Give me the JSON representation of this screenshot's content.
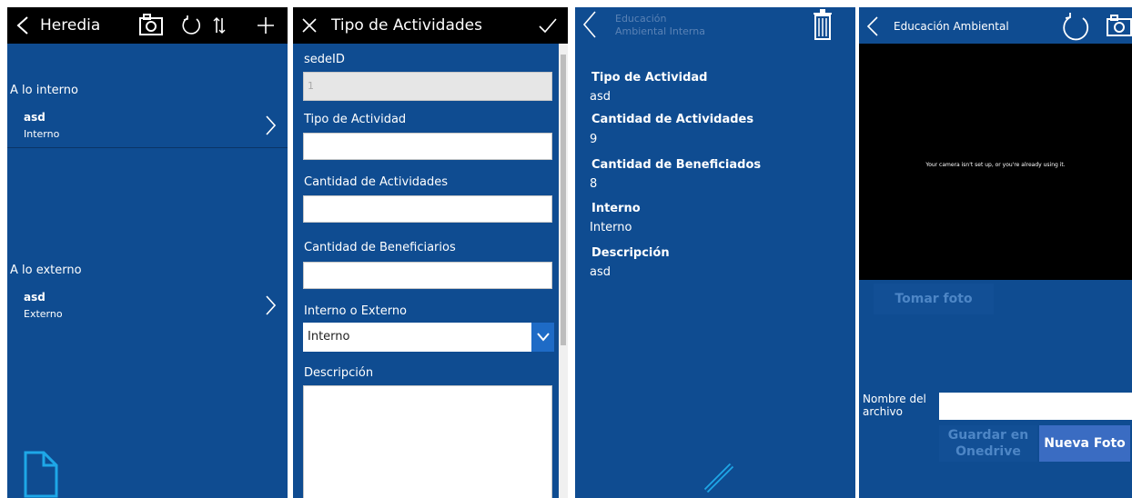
{
  "panel1": {
    "title": "Heredia",
    "groups": [
      {
        "label": "A lo interno",
        "item": {
          "title": "asd",
          "subtitle": "Interno"
        }
      },
      {
        "label": "A lo externo",
        "item": {
          "title": "asd",
          "subtitle": "Externo"
        }
      }
    ]
  },
  "panel2": {
    "title": "Tipo de Actividades",
    "fields": {
      "sede_label": "sedeID",
      "sede_value": "1",
      "tipo_label": "Tipo de Actividad",
      "cant_act_label": "Cantidad de Actividades",
      "cant_ben_label": "Cantidad de Beneficiarios",
      "int_ext_label": "Interno o Externo",
      "int_ext_value": "Interno",
      "desc_label": "Descripción"
    }
  },
  "panel3": {
    "header_line1": "Educación",
    "header_line2": "Ambiental Interna",
    "details": [
      {
        "label": "Tipo de Actividad",
        "value": "asd"
      },
      {
        "label": "Cantidad de Actividades",
        "value": "9"
      },
      {
        "label": "Cantidad de Beneficiados",
        "value": "8"
      },
      {
        "label": "Interno",
        "value": "Interno"
      },
      {
        "label": "Descripción",
        "value": "asd"
      }
    ]
  },
  "panel4": {
    "title": "Educación Ambiental",
    "camera_message": "Your camera isn't set up, or you're already using it.",
    "take_photo": "Tomar foto",
    "filename_label_1": "Nombre del",
    "filename_label_2": "archivo",
    "save_line1": "Guardar en",
    "save_line2": "Onedrive",
    "new_photo": "Nueva Foto"
  },
  "colors": {
    "app_blue": "#0f4c91",
    "header_black": "#000000",
    "accent": "#3a6cc2"
  }
}
